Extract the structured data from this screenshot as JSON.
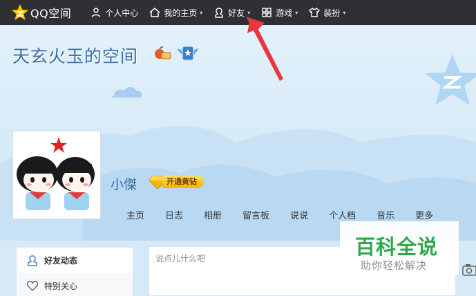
{
  "topnav": {
    "logo_text": "QQ空间",
    "items": [
      {
        "label": "个人中心",
        "icon": "person-icon",
        "has_caret": false
      },
      {
        "label": "我的主页",
        "icon": "home-icon",
        "has_caret": true
      },
      {
        "label": "好友",
        "icon": "friends-icon",
        "has_caret": true
      },
      {
        "label": "游戏",
        "icon": "grid-icon",
        "has_caret": true
      },
      {
        "label": "装扮",
        "icon": "shirt-icon",
        "has_caret": true
      }
    ],
    "caret": "▾"
  },
  "banner": {
    "space_title": "天玄火玉的空间",
    "nickname": "小傑",
    "vip_label": "开通黄钻",
    "tabs": [
      "主页",
      "日志",
      "相册",
      "留言板",
      "说说",
      "个人档",
      "音乐",
      "更多"
    ]
  },
  "sidebar": {
    "items": [
      {
        "label": "好友动态",
        "icon": "person-outline-icon",
        "active": true
      },
      {
        "label": "特别关心",
        "icon": "heart-icon",
        "active": false
      }
    ]
  },
  "post": {
    "placeholder": "说点儿什么吧",
    "value": ""
  },
  "watermark": {
    "main": "百科全说",
    "sub": "助你轻松解决"
  },
  "colors": {
    "nav_bg": "#2f3033",
    "title_blue": "#3a6ea8",
    "arrow_red": "#e8373a",
    "watermark_green": "#2da84a",
    "logo_yellow": "#ffc400"
  }
}
